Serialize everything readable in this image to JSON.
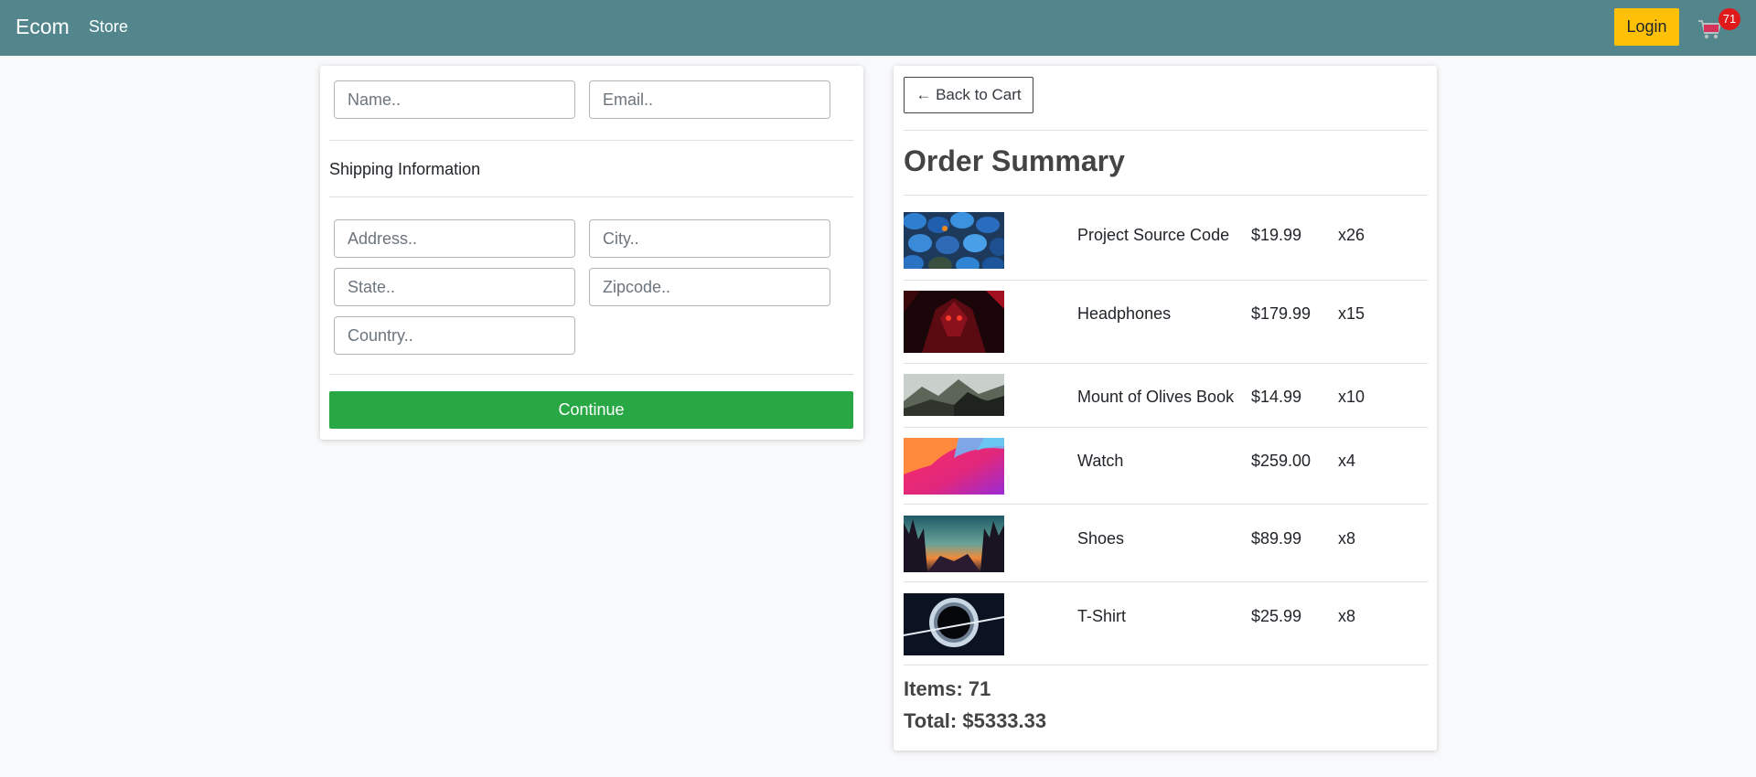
{
  "navbar": {
    "brand": "Ecom",
    "store_link": "Store",
    "login_label": "Login",
    "cart_count": "71",
    "bg_color": "#52868c",
    "login_color": "#ffc107"
  },
  "form": {
    "name_placeholder": "Name..",
    "email_placeholder": "Email..",
    "shipping_heading": "Shipping Information",
    "address_placeholder": "Address..",
    "city_placeholder": "City..",
    "state_placeholder": "State..",
    "zipcode_placeholder": "Zipcode..",
    "country_placeholder": "Country..",
    "continue_label": "Continue",
    "continue_color": "#28a745"
  },
  "summary": {
    "back_label": "← Back to Cart",
    "title": "Order Summary",
    "items": [
      {
        "name": "Project Source Code",
        "price": "$19.99",
        "qty": "x26",
        "thumb": "blue-eggs-image"
      },
      {
        "name": "Headphones",
        "price": "$179.99",
        "qty": "x15",
        "thumb": "red-demon-image"
      },
      {
        "name": "Mount of Olives Book",
        "price": "$14.99",
        "qty": "x10",
        "thumb": "mountain-landscape-image"
      },
      {
        "name": "Watch",
        "price": "$259.00",
        "qty": "x4",
        "thumb": "gradient-waves-image"
      },
      {
        "name": "Shoes",
        "price": "$89.99",
        "qty": "x8",
        "thumb": "forest-sunset-image"
      },
      {
        "name": "T-Shirt",
        "price": "$25.99",
        "qty": "x8",
        "thumb": "black-hole-image"
      }
    ],
    "items_total": "Items: 71",
    "price_total": "Total: $5333.33"
  }
}
